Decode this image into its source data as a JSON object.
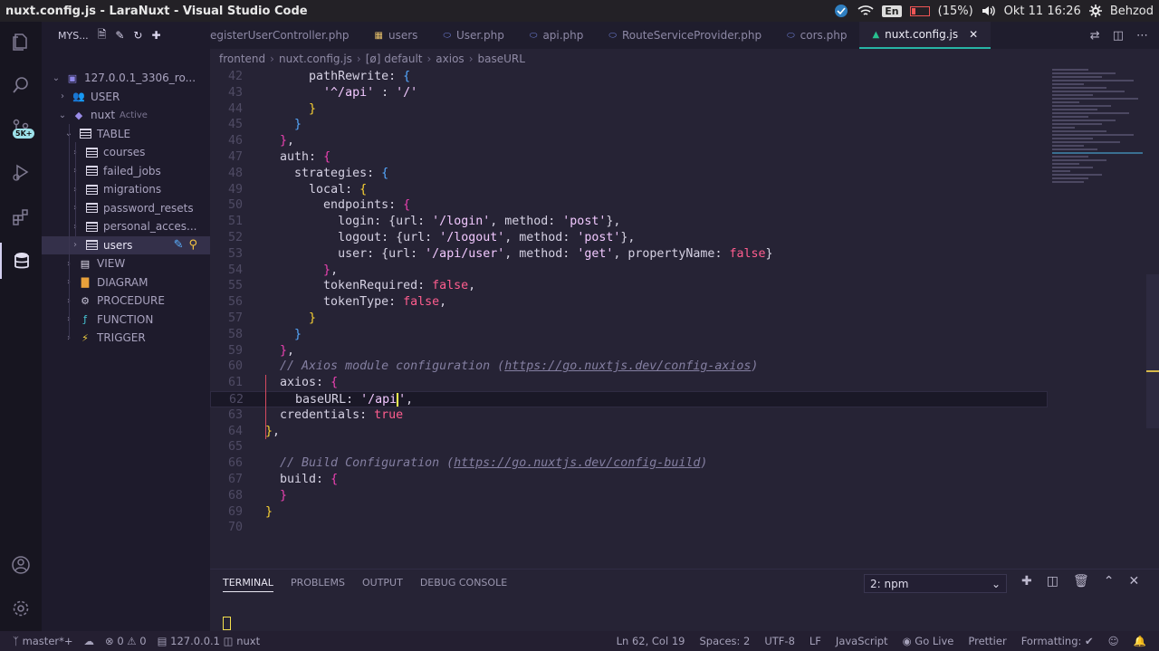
{
  "os_bar": {
    "window_title": "nuxt.config.js - LaraNuxt - Visual Studio Code",
    "battery": "(15%)",
    "language": "En",
    "datetime": "Okt 11 16:26",
    "user": "Behzod"
  },
  "activity_bar": {
    "badge": "5K+",
    "items": [
      "explorer-icon",
      "search-icon",
      "source-control-icon",
      "run-debug-icon",
      "extensions-icon",
      "database-icon"
    ],
    "bottom": [
      "account-icon",
      "settings-icon"
    ]
  },
  "sidebar": {
    "title": "MYS...",
    "tree": [
      {
        "label": "127.0.0.1_3306_ro...",
        "level": 0,
        "chevron": "v",
        "icon": "server"
      },
      {
        "label": "USER",
        "level": 1,
        "chevron": ">",
        "icon": "users"
      },
      {
        "label": "nuxt",
        "tag": "Active",
        "level": 1,
        "chevron": "v",
        "icon": "db"
      },
      {
        "label": "TABLE",
        "level": 2,
        "chevron": "v",
        "icon": "table"
      },
      {
        "label": "courses",
        "level": 3,
        "chevron": ">",
        "icon": "table"
      },
      {
        "label": "failed_jobs",
        "level": 3,
        "chevron": ">",
        "icon": "table"
      },
      {
        "label": "migrations",
        "level": 3,
        "chevron": ">",
        "icon": "table"
      },
      {
        "label": "password_resets",
        "level": 3,
        "chevron": ">",
        "icon": "table"
      },
      {
        "label": "personal_acces...",
        "level": 3,
        "chevron": ">",
        "icon": "table"
      },
      {
        "label": "users",
        "level": 3,
        "chevron": ">",
        "icon": "table",
        "selected": true
      },
      {
        "label": "VIEW",
        "level": 2,
        "chevron": ">",
        "icon": "view"
      },
      {
        "label": "DIAGRAM",
        "level": 2,
        "chevron": ">",
        "icon": "diagram"
      },
      {
        "label": "PROCEDURE",
        "level": 2,
        "chevron": ">",
        "icon": "procedure"
      },
      {
        "label": "FUNCTION",
        "level": 2,
        "chevron": ">",
        "icon": "function"
      },
      {
        "label": "TRIGGER",
        "level": 2,
        "chevron": ">",
        "icon": "trigger"
      }
    ]
  },
  "tabs": [
    {
      "label": "egisterUserController.php",
      "icon": "php",
      "active": false
    },
    {
      "label": "users",
      "icon": "table",
      "active": false
    },
    {
      "label": "User.php",
      "icon": "php",
      "active": false
    },
    {
      "label": "api.php",
      "icon": "php",
      "active": false
    },
    {
      "label": "RouteServiceProvider.php",
      "icon": "php",
      "active": false
    },
    {
      "label": "cors.php",
      "icon": "php",
      "active": false
    },
    {
      "label": "nuxt.config.js",
      "icon": "nuxt",
      "active": true
    }
  ],
  "breadcrumb": [
    "frontend",
    "nuxt.config.js",
    "[ø] default",
    "axios",
    "baseURL"
  ],
  "editor": {
    "current_line": 62,
    "lines": [
      {
        "n": 42,
        "tokens": [
          [
            "      ",
            ""
          ],
          [
            "pathRewrite",
            "prop"
          ],
          [
            ": ",
            "punc"
          ],
          [
            "{",
            "b3"
          ]
        ]
      },
      {
        "n": 43,
        "tokens": [
          [
            "        ",
            ""
          ],
          [
            "'^/api'",
            "str"
          ],
          [
            " : ",
            "punc"
          ],
          [
            "'/'",
            "str"
          ]
        ]
      },
      {
        "n": 44,
        "tokens": [
          [
            "      ",
            ""
          ],
          [
            "}",
            "b1"
          ]
        ]
      },
      {
        "n": 45,
        "tokens": [
          [
            "    ",
            ""
          ],
          [
            "}",
            "b3"
          ]
        ]
      },
      {
        "n": 46,
        "tokens": [
          [
            "  ",
            ""
          ],
          [
            "}",
            "b2"
          ],
          [
            ",",
            "punc"
          ]
        ]
      },
      {
        "n": 47,
        "tokens": [
          [
            "  ",
            ""
          ],
          [
            "auth",
            "prop"
          ],
          [
            ": ",
            "punc"
          ],
          [
            "{",
            "b2"
          ]
        ]
      },
      {
        "n": 48,
        "tokens": [
          [
            "    ",
            ""
          ],
          [
            "strategies",
            "prop"
          ],
          [
            ": ",
            "punc"
          ],
          [
            "{",
            "b3"
          ]
        ]
      },
      {
        "n": 49,
        "tokens": [
          [
            "      ",
            ""
          ],
          [
            "local",
            "prop"
          ],
          [
            ": ",
            "punc"
          ],
          [
            "{",
            "b1"
          ]
        ]
      },
      {
        "n": 50,
        "tokens": [
          [
            "        ",
            ""
          ],
          [
            "endpoints",
            "prop"
          ],
          [
            ": ",
            "punc"
          ],
          [
            "{",
            "b2"
          ]
        ]
      },
      {
        "n": 51,
        "tokens": [
          [
            "          ",
            ""
          ],
          [
            "login",
            "prop"
          ],
          [
            ": {",
            "punc"
          ],
          [
            "url",
            "prop"
          ],
          [
            ": ",
            "punc"
          ],
          [
            "'/login'",
            "str"
          ],
          [
            ", ",
            "punc"
          ],
          [
            "method",
            "prop"
          ],
          [
            ": ",
            "punc"
          ],
          [
            "'post'",
            "str"
          ],
          [
            "},",
            "punc"
          ]
        ]
      },
      {
        "n": 52,
        "tokens": [
          [
            "          ",
            ""
          ],
          [
            "logout",
            "prop"
          ],
          [
            ": {",
            "punc"
          ],
          [
            "url",
            "prop"
          ],
          [
            ": ",
            "punc"
          ],
          [
            "'/logout'",
            "str"
          ],
          [
            ", ",
            "punc"
          ],
          [
            "method",
            "prop"
          ],
          [
            ": ",
            "punc"
          ],
          [
            "'post'",
            "str"
          ],
          [
            "},",
            "punc"
          ]
        ]
      },
      {
        "n": 53,
        "tokens": [
          [
            "          ",
            ""
          ],
          [
            "user",
            "prop"
          ],
          [
            ": {",
            "punc"
          ],
          [
            "url",
            "prop"
          ],
          [
            ": ",
            "punc"
          ],
          [
            "'/api/user'",
            "str"
          ],
          [
            ", ",
            "punc"
          ],
          [
            "method",
            "prop"
          ],
          [
            ": ",
            "punc"
          ],
          [
            "'get'",
            "str"
          ],
          [
            ", ",
            "punc"
          ],
          [
            "propertyName",
            "prop"
          ],
          [
            ": ",
            "punc"
          ],
          [
            "false",
            "bool"
          ],
          [
            "}",
            "punc"
          ]
        ]
      },
      {
        "n": 54,
        "tokens": [
          [
            "        ",
            ""
          ],
          [
            "}",
            "b2"
          ],
          [
            ",",
            "punc"
          ]
        ]
      },
      {
        "n": 55,
        "tokens": [
          [
            "        ",
            ""
          ],
          [
            "tokenRequired",
            "prop"
          ],
          [
            ": ",
            "punc"
          ],
          [
            "false",
            "bool"
          ],
          [
            ",",
            "punc"
          ]
        ]
      },
      {
        "n": 56,
        "tokens": [
          [
            "        ",
            ""
          ],
          [
            "tokenType",
            "prop"
          ],
          [
            ": ",
            "punc"
          ],
          [
            "false",
            "bool"
          ],
          [
            ",",
            "punc"
          ]
        ]
      },
      {
        "n": 57,
        "tokens": [
          [
            "      ",
            ""
          ],
          [
            "}",
            "b1"
          ]
        ]
      },
      {
        "n": 58,
        "tokens": [
          [
            "    ",
            ""
          ],
          [
            "}",
            "b3"
          ]
        ]
      },
      {
        "n": 59,
        "tokens": [
          [
            "  ",
            ""
          ],
          [
            "}",
            "b2"
          ],
          [
            ",",
            "punc"
          ]
        ]
      },
      {
        "n": 60,
        "tokens": [
          [
            "  ",
            ""
          ],
          [
            "// Axios module configuration (",
            "comment"
          ],
          [
            "https://go.nuxtjs.dev/config-axios",
            "url"
          ],
          [
            ")",
            "comment"
          ]
        ]
      },
      {
        "n": 61,
        "tokens": [
          [
            "  ",
            ""
          ],
          [
            "axios",
            "prop"
          ],
          [
            ": ",
            "punc"
          ],
          [
            "{",
            "b2"
          ]
        ]
      },
      {
        "n": 62,
        "tokens": [
          [
            "    ",
            ""
          ],
          [
            "baseURL",
            "prop"
          ],
          [
            ": ",
            "punc"
          ],
          [
            "'/api",
            "str"
          ],
          [
            "|",
            "cursor"
          ],
          [
            "'",
            "str"
          ],
          [
            ",",
            "punc"
          ]
        ]
      },
      {
        "n": 63,
        "tokens": [
          [
            "  ",
            ""
          ],
          [
            "credentials",
            "prop"
          ],
          [
            ": ",
            "punc"
          ],
          [
            "true",
            "bool"
          ]
        ]
      },
      {
        "n": 64,
        "tokens": [
          [
            "",
            ""
          ],
          [
            "}",
            "b1"
          ],
          [
            ",",
            "punc"
          ]
        ]
      },
      {
        "n": 65,
        "tokens": []
      },
      {
        "n": 66,
        "tokens": [
          [
            "  ",
            ""
          ],
          [
            "// Build Configuration (",
            "comment"
          ],
          [
            "https://go.nuxtjs.dev/config-build",
            "url"
          ],
          [
            ")",
            "comment"
          ]
        ]
      },
      {
        "n": 67,
        "tokens": [
          [
            "  ",
            ""
          ],
          [
            "build",
            "prop"
          ],
          [
            ": ",
            "punc"
          ],
          [
            "{",
            "b2"
          ]
        ]
      },
      {
        "n": 68,
        "tokens": [
          [
            "  ",
            ""
          ],
          [
            "}",
            "b2"
          ]
        ]
      },
      {
        "n": 69,
        "tokens": [
          [
            "",
            ""
          ],
          [
            "}",
            "b1"
          ]
        ]
      },
      {
        "n": 70,
        "tokens": []
      }
    ]
  },
  "panel": {
    "tabs": [
      "TERMINAL",
      "PROBLEMS",
      "OUTPUT",
      "DEBUG CONSOLE"
    ],
    "active_tab": "TERMINAL",
    "terminal_select": "2: npm"
  },
  "status_bar": {
    "branch": "master*+",
    "errors": "0",
    "warnings": "0",
    "db_host": "127.0.0.1",
    "db_name": "nuxt",
    "position": "Ln 62, Col 19",
    "spaces": "Spaces: 2",
    "encoding": "UTF-8",
    "eol": "LF",
    "language": "JavaScript",
    "golive": "Go Live",
    "prettier": "Prettier",
    "formatting": "Formatting: ✔"
  },
  "colors": {
    "background": "#262335",
    "accent_tab": "#27b5a6",
    "string": "#f2c8ff",
    "bool": "#fe5d8e",
    "bracket_yellow": "#fbd333",
    "bracket_pink": "#ed42b3",
    "bracket_blue": "#55a8ff"
  }
}
